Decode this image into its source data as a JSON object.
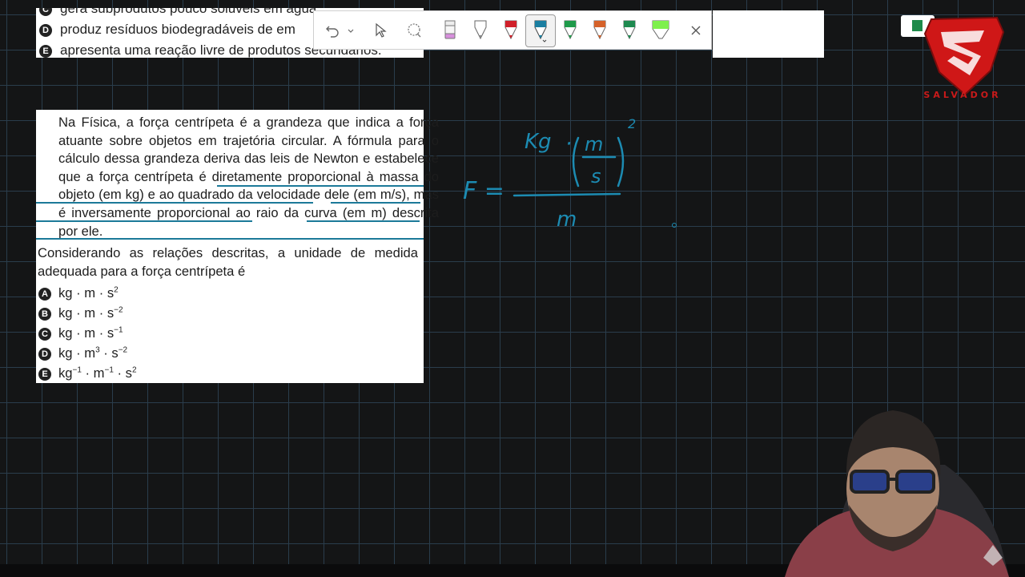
{
  "previous_question": {
    "options": [
      {
        "letter": "C",
        "text": "gera subprodutos pouco solúveis em água."
      },
      {
        "letter": "D",
        "text": "produz resíduos biodegradáveis de em"
      },
      {
        "letter": "E",
        "text": "apresenta uma reação livre de produtos secundários."
      }
    ]
  },
  "toolbar": {
    "tools": [
      {
        "icon": "undo-icon"
      },
      {
        "icon": "undo-dropdown-chevron-icon"
      },
      {
        "icon": "select-pointer-icon"
      },
      {
        "icon": "lasso-icon"
      },
      {
        "icon": "highlighter-pink-icon",
        "color": "#d78fdc"
      },
      {
        "icon": "pen-white-icon",
        "color": "#ffffff"
      },
      {
        "icon": "pen-red-icon",
        "color": "#d0202a"
      },
      {
        "icon": "pen-blue-icon",
        "color": "#1b7ea0",
        "selected": true
      },
      {
        "icon": "pen-green-icon",
        "color": "#1f9a4a"
      },
      {
        "icon": "pen-orange-icon",
        "color": "#d5622a"
      },
      {
        "icon": "pen-dark-green-icon",
        "color": "#1f8a50"
      },
      {
        "icon": "highlighter-lime-icon",
        "color": "#7ef04d"
      },
      {
        "icon": "close-icon"
      }
    ]
  },
  "question": {
    "paragraph_parts": [
      "Na Física, a força centrípeta é a grandeza que indica a força atuante sobre objetos em trajetória circular. A fórmula para o cálculo dessa grandeza deriva das leis de Newton e estabelece que a ",
      "força centrípeta é diretamente proporcional à massa do objeto (em kg)",
      " e ",
      "ao quadrado da velocidade dele (em m/s)",
      ", mas ",
      "é inversamente proporcional ao raio da curva (em m) descrita por ele",
      "."
    ],
    "prompt": "Considerando as relações descritas, a unidade de medida adequada para a força centrípeta é",
    "choices": [
      {
        "letter": "A",
        "base": "kg · m · s",
        "sup": "2",
        "tail": ""
      },
      {
        "letter": "B",
        "base": "kg · m · s",
        "sup": "−2",
        "tail": ""
      },
      {
        "letter": "C",
        "base": "kg · m · s",
        "sup": "−1",
        "tail": ""
      },
      {
        "letter": "D",
        "base": "kg · m",
        "sup": "3",
        "tail": " · s",
        "sup2": "−2"
      },
      {
        "letter": "E",
        "base": "kg",
        "sup": "−1",
        "tail": " · m",
        "sup2": "−1",
        "tail2": " · s",
        "sup3": "2"
      }
    ]
  },
  "handwriting": {
    "lhs": "F =",
    "numerator_kg": "Kg",
    "dot": "·",
    "frac_num": "m",
    "frac_den": "s",
    "exponent": "2",
    "denominator": "m",
    "ink_color": "#1c8bb2"
  },
  "logo": {
    "text": "SALVADOR",
    "color": "#c91a1a"
  },
  "colors": {
    "underline": "#1c7a99",
    "board": "#141516",
    "grid": "#2a3d4c"
  }
}
